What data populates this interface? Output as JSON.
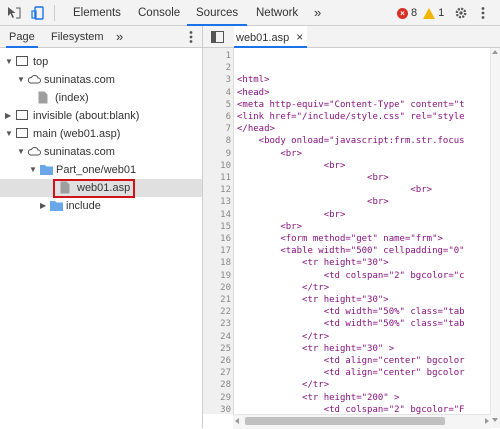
{
  "toolbar": {
    "tabs": [
      "Elements",
      "Console",
      "Sources",
      "Network"
    ],
    "active_tab": "Sources",
    "more": "»",
    "error_count": "8",
    "warning_count": "1"
  },
  "navigator": {
    "tabs": [
      "Page",
      "Filesystem"
    ],
    "more": "»",
    "tree": [
      {
        "label": "top"
      },
      {
        "label": "suninatas.com"
      },
      {
        "label": "(index)"
      },
      {
        "label": "invisible (about:blank)"
      },
      {
        "label": "main (web01.asp)"
      },
      {
        "label": "suninatas.com"
      },
      {
        "label": "Part_one/web01"
      },
      {
        "label": "web01.asp"
      },
      {
        "label": "include"
      }
    ]
  },
  "editor": {
    "file_tab": "web01.asp",
    "close": "×",
    "line_numbers": [
      "1",
      "2",
      "3",
      "4",
      "5",
      "6",
      "7",
      "8",
      "9",
      "10",
      "11",
      "12",
      "13",
      "14",
      "15",
      "16",
      "17",
      "18",
      "19",
      "20",
      "21",
      "22",
      "23",
      "24",
      "25",
      "26",
      "27",
      "28",
      "29",
      "30"
    ],
    "lines": [
      "",
      "",
      "<html>",
      "<head>",
      "<meta http-equiv=\"Content-Type\" content=\"t",
      "<link href=\"/include/style.css\" rel=\"style",
      "</head>",
      "    <body onload=\"javascript:frm.str.focus",
      "        <br>",
      "                <br>",
      "                        <br>",
      "                                <br>",
      "                        <br>",
      "                <br>",
      "        <br>",
      "        <form method=\"get\" name=\"frm\">",
      "        <table width=\"500\" cellpadding=\"0\"",
      "            <tr height=\"30\">",
      "                <td colspan=\"2\" bgcolor=\"c",
      "            </tr>",
      "            <tr height=\"30\">",
      "                <td width=\"50%\" class=\"tab",
      "                <td width=\"50%\" class=\"tab",
      "            </tr>",
      "            <tr height=\"30\" >",
      "                <td align=\"center\" bgcolor",
      "                <td align=\"center\" bgcolor",
      "            </tr>",
      "            <tr height=\"200\" >",
      "                <td colspan=\"2\" bgcolor=\"F"
    ]
  }
}
